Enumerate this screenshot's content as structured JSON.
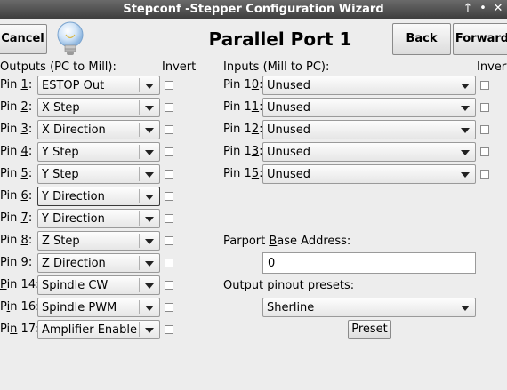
{
  "window": {
    "title": "Stepconf -Stepper Configuration Wizard",
    "controls": [
      "↑",
      "•",
      "✕"
    ]
  },
  "header": {
    "cancel": "Cancel",
    "page_title": "Parallel Port 1",
    "back": "Back",
    "forward": "Forward"
  },
  "outputs": {
    "heading": "Outputs (PC to Mill):",
    "invert_heading": "Invert",
    "pins": [
      {
        "pre": "Pin ",
        "key": "1",
        "post": ":",
        "value": "ESTOP Out"
      },
      {
        "pre": "Pin ",
        "key": "2",
        "post": ":",
        "value": "X Step"
      },
      {
        "pre": "Pin ",
        "key": "3",
        "post": ":",
        "value": "X Direction"
      },
      {
        "pre": "Pin ",
        "key": "4",
        "post": ":",
        "value": "Y Step"
      },
      {
        "pre": "Pin ",
        "key": "5",
        "post": ":",
        "value": "Y Step"
      },
      {
        "pre": "Pin ",
        "key": "6",
        "post": ":",
        "value": "Y Direction"
      },
      {
        "pre": "Pin ",
        "key": "7",
        "post": ":",
        "value": "Y Direction"
      },
      {
        "pre": "Pin ",
        "key": "8",
        "post": ":",
        "value": "Z Step"
      },
      {
        "pre": "Pin ",
        "key": "9",
        "post": ":",
        "value": "Z Direction"
      },
      {
        "pre": "",
        "key": "P",
        "post": "in 14:",
        "value": "Spindle CW"
      },
      {
        "pre": "P",
        "key": "i",
        "post": "n 16:",
        "value": "Spindle PWM"
      },
      {
        "pre": "Pi",
        "key": "n",
        "post": " 17:",
        "value": "Amplifier Enable"
      }
    ]
  },
  "inputs": {
    "heading": "Inputs (Mill to PC):",
    "invert_heading": "Invert",
    "pins": [
      {
        "pre": "Pin 1",
        "key": "0",
        "post": ":",
        "value": "Unused"
      },
      {
        "pre": "Pin 1",
        "key": "1",
        "post": ":",
        "value": "Unused"
      },
      {
        "pre": "Pin 1",
        "key": "2",
        "post": ":",
        "value": "Unused"
      },
      {
        "pre": "Pin 1",
        "key": "3",
        "post": ":",
        "value": "Unused"
      },
      {
        "pre": "Pin 1",
        "key": "5",
        "post": ":",
        "value": "Unused"
      }
    ]
  },
  "parport": {
    "label_pre": "Parport ",
    "label_key": "B",
    "label_post": "ase Address:",
    "value": "0"
  },
  "presets": {
    "label": "Output pinout presets:",
    "value": "Sherline",
    "button": "Preset"
  }
}
